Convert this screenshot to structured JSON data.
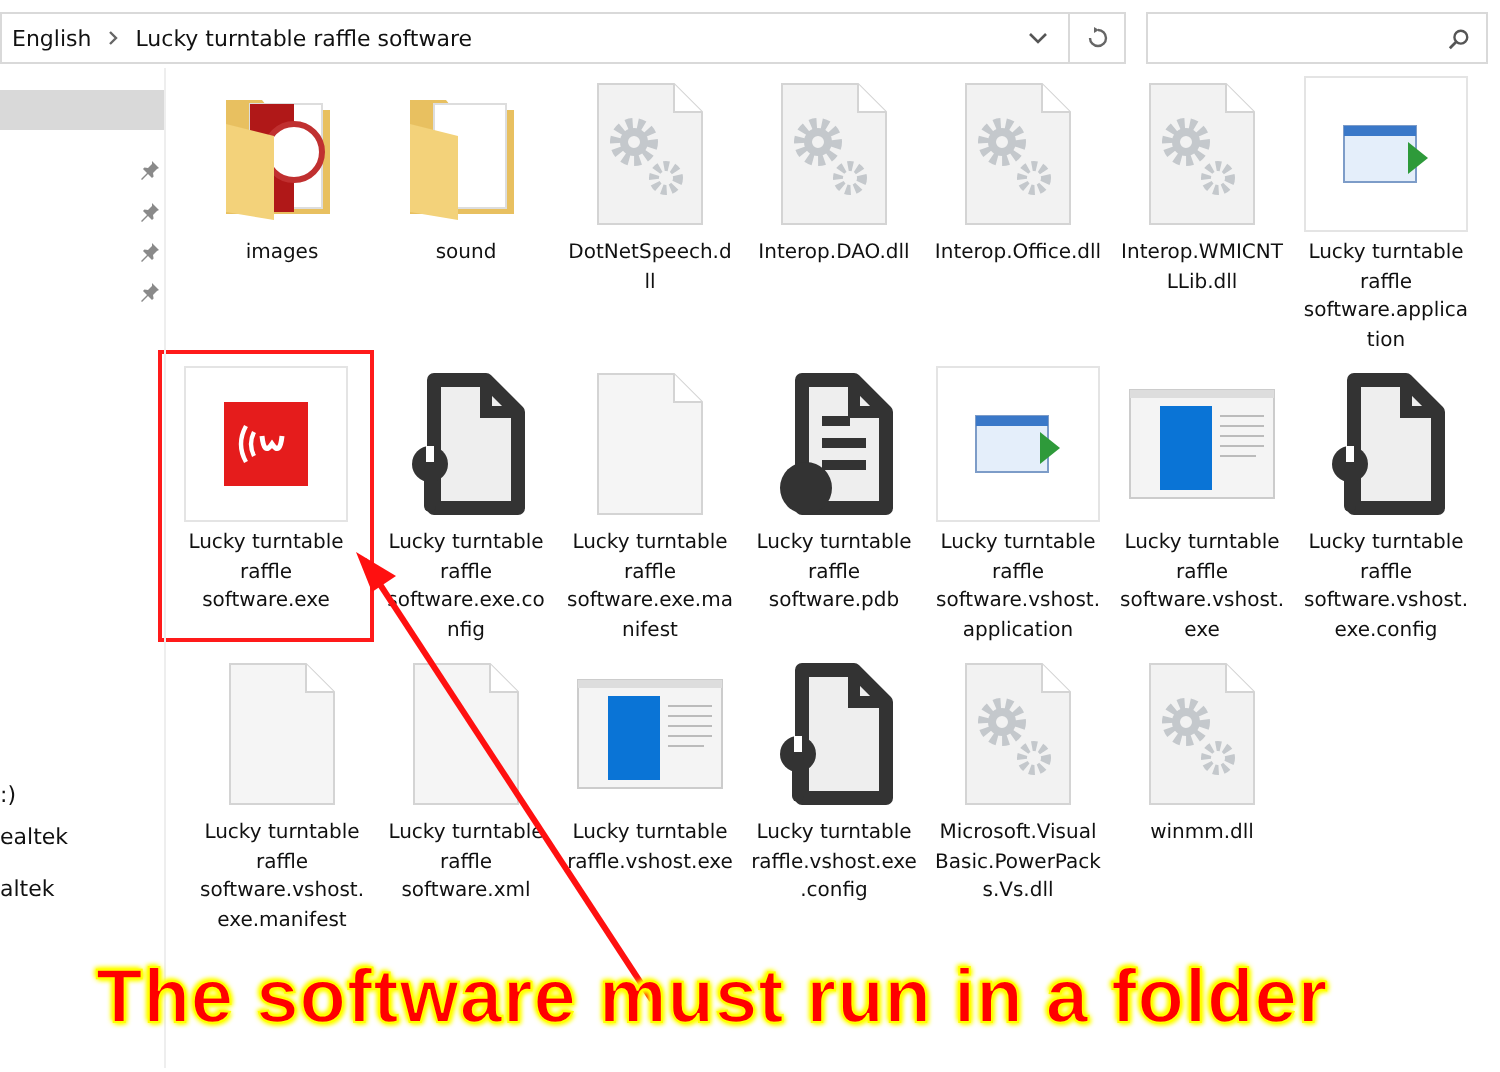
{
  "address_bar": {
    "path": [
      "English",
      "Lucky turntable raffle software"
    ]
  },
  "sidebar": {
    "items": [
      {
        "text": ":)"
      },
      {
        "text": "ealtek"
      },
      {
        "text": "altek"
      }
    ]
  },
  "files": [
    {
      "name": "images",
      "kind": "folder-images",
      "highlighted": false
    },
    {
      "name": "sound",
      "kind": "folder",
      "highlighted": false
    },
    {
      "name": "DotNetSpeech.dll",
      "kind": "gears",
      "highlighted": false
    },
    {
      "name": "Interop.DAO.dll",
      "kind": "gears",
      "highlighted": false
    },
    {
      "name": "Interop.Office.dll",
      "kind": "gears",
      "highlighted": false
    },
    {
      "name": "Interop.WMICNTLLib.dll",
      "kind": "gears",
      "highlighted": false
    },
    {
      "name": "Lucky turntable raffle software.application",
      "kind": "application",
      "highlighted": false
    },
    {
      "name": "Lucky turntable raffle software.exe",
      "kind": "exe",
      "highlighted": true
    },
    {
      "name": "Lucky turntable raffle software.exe.config",
      "kind": "config",
      "highlighted": false
    },
    {
      "name": "Lucky turntable raffle software.exe.manifest",
      "kind": "blank",
      "highlighted": false
    },
    {
      "name": "Lucky turntable raffle software.pdb",
      "kind": "pdb",
      "highlighted": false
    },
    {
      "name": "Lucky turntable raffle software.vshost.application",
      "kind": "application",
      "highlighted": false
    },
    {
      "name": "Lucky turntable raffle software.vshost.exe",
      "kind": "window",
      "highlighted": false
    },
    {
      "name": "Lucky turntable raffle software.vshost.exe.config",
      "kind": "config",
      "highlighted": false
    },
    {
      "name": "Lucky turntable raffle software.vshost.exe.manifest",
      "kind": "blank",
      "highlighted": false
    },
    {
      "name": "Lucky turntable raffle software.xml",
      "kind": "blank",
      "highlighted": false
    },
    {
      "name": "Lucky turntable raffle.vshost.exe",
      "kind": "window",
      "highlighted": false
    },
    {
      "name": "Lucky turntable raffle.vshost.exe.config",
      "kind": "config",
      "highlighted": false
    },
    {
      "name": "Microsoft.VisualBasic.PowerPacks.Vs.dll",
      "kind": "gears",
      "highlighted": false
    },
    {
      "name": "winmm.dll",
      "kind": "gears",
      "highlighted": false
    }
  ],
  "caption": "The software must run in a folder"
}
